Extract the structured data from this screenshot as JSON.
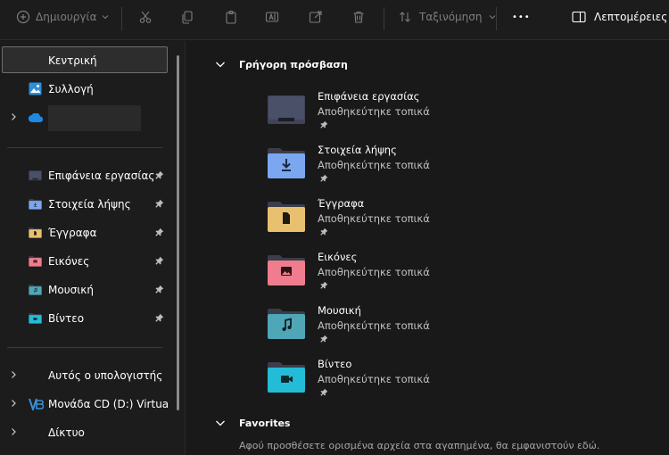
{
  "toolbar": {
    "new_label": "Δημιουργία",
    "sort_label": "Ταξινόμηση",
    "more_label": "•••",
    "details_label": "Λεπτομέρειες"
  },
  "sidebar": {
    "home_label": "Κεντρική",
    "gallery_label": "Συλλογή",
    "pinned": [
      {
        "label": "Επιφάνεια εργασίας",
        "icon": "desktop-folder-icon"
      },
      {
        "label": "Στοιχεία λήψης",
        "icon": "downloads-folder-icon"
      },
      {
        "label": "Έγγραφα",
        "icon": "documents-folder-icon"
      },
      {
        "label": "Εικόνες",
        "icon": "pictures-folder-icon"
      },
      {
        "label": "Μουσική",
        "icon": "music-folder-icon"
      },
      {
        "label": "Βίντεο",
        "icon": "videos-folder-icon"
      }
    ],
    "this_pc_label": "Αυτός ο υπολογιστής",
    "cd_drive_label": "Μονάδα CD (D:) VirtualBo",
    "network_label": "Δίκτυο"
  },
  "main": {
    "quick_access_title": "Γρήγορη πρόσβαση",
    "quick_access": [
      {
        "name": "Επιφάνεια εργασίας",
        "sub": "Αποθηκεύτηκε τοπικά",
        "icon": "desktop-folder-icon"
      },
      {
        "name": "Στοιχεία λήψης",
        "sub": "Αποθηκεύτηκε τοπικά",
        "icon": "downloads-folder-icon"
      },
      {
        "name": "Έγγραφα",
        "sub": "Αποθηκεύτηκε τοπικά",
        "icon": "documents-folder-icon"
      },
      {
        "name": "Εικόνες",
        "sub": "Αποθηκεύτηκε τοπικά",
        "icon": "pictures-folder-icon"
      },
      {
        "name": "Μουσική",
        "sub": "Αποθηκεύτηκε τοπικά",
        "icon": "music-folder-icon"
      },
      {
        "name": "Βίντεο",
        "sub": "Αποθηκεύτηκε τοπικά",
        "icon": "videos-folder-icon"
      }
    ],
    "favorites_title": "Favorites",
    "favorites_empty": "Αφού προσθέσετε ορισμένα αρχεία στα αγαπημένα, θα εμφανιστούν εδώ."
  },
  "colors": {
    "background": "#191919",
    "panel": "#1c1c1c",
    "desktop": "#4a5068",
    "downloads": "#7ba7f0",
    "documents": "#e8c06f",
    "pictures": "#ef7d8e",
    "music": "#4fa6b6",
    "videos": "#23bcd6"
  }
}
